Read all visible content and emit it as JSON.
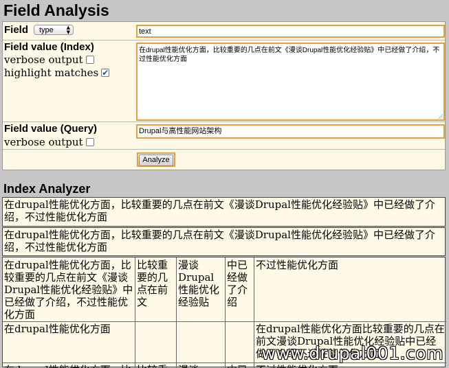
{
  "page": {
    "title": "Field Analysis"
  },
  "form": {
    "field_label": "Field",
    "field_select": {
      "value": "type"
    },
    "field_input": "text",
    "index_label": "Field value (Index)",
    "index_verbose": {
      "label": "verbose output",
      "checked": false
    },
    "index_highlight": {
      "label": "highlight matches",
      "checked": true
    },
    "index_text": "在drupal性能优化方面，比较重要的几点在前文《漫谈Drupal性能优化经验贴》中已经做了介绍，不过性能优化方面",
    "query_label": "Field value (Query)",
    "query_verbose": {
      "label": "verbose output",
      "checked": false
    },
    "query_input": "Drupal与高性能网站架构",
    "analyze_button": "Analyze"
  },
  "analyzer": {
    "title": "Index Analyzer",
    "row1": "在drupal性能优化方面，比较重要的几点在前文《漫谈Drupal性能优化经验贴》中已经做了介绍，不过性能优化方面",
    "row2": "在drupal性能优化方面，比较重要的几点在前文《漫谈Drupal性能优化经验贴》中已经做了介绍，不过性能优化方面",
    "grid": {
      "r1c1": "在drupal性能优化方面，比较重要的几点在前文《漫谈Drupal性能优化经验贴》中已经做了介绍，不过性能优化方面",
      "r1c2": "比较重要的几点在前文",
      "r1c3": "漫谈Drupal性能优化经验贴",
      "r1c4": "中已经做了介绍",
      "r1c5": "不过性能优化方面",
      "r2c1": "在drupal性能优化方面",
      "r2c5": "在drupal性能优化方面比较重要的几点在前文漫谈Drupal性能优化经验贴中已经做了介绍不过性能优化方面",
      "r3c1": "在drupal性能优化方面，比",
      "r3c2": "比较重",
      "r3c3": "漫谈",
      "r3c4": "中已",
      "r3c5": "不过性能优化方面"
    }
  },
  "watermark": "www.drupal001.com"
}
